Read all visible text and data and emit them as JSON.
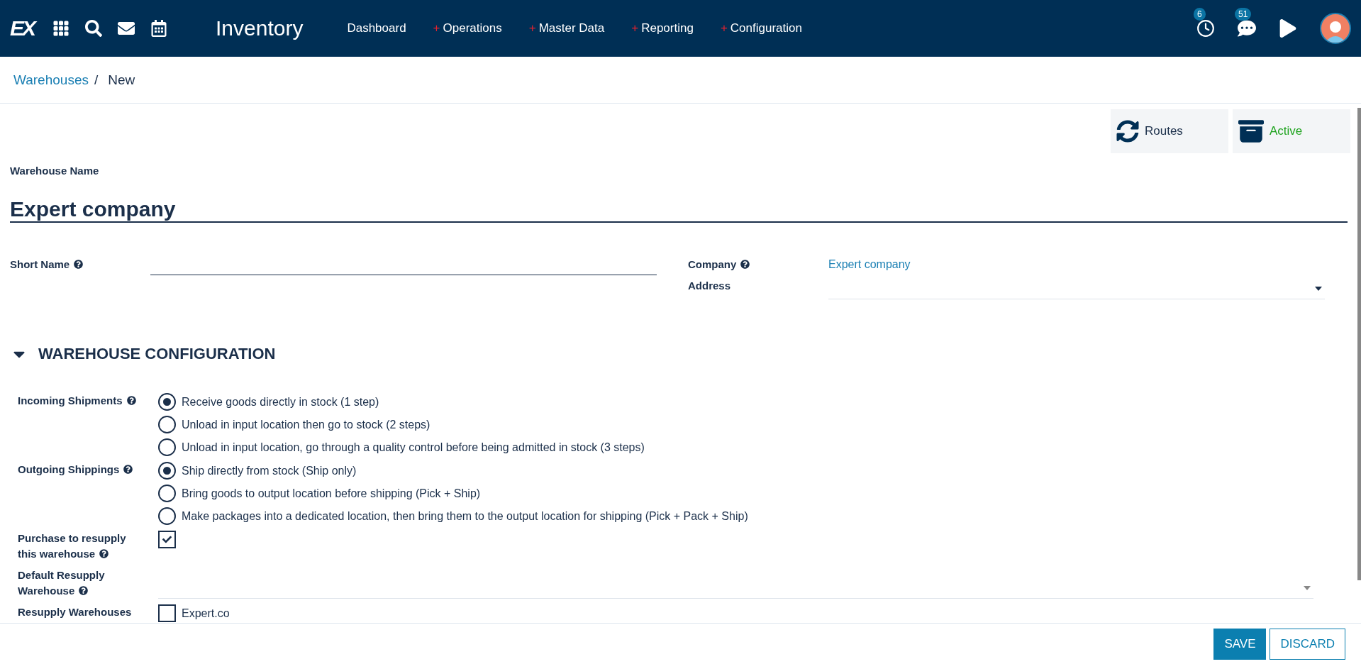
{
  "navbar": {
    "logo": "EX",
    "app_title": "Inventory",
    "menu": [
      {
        "label": "Dashboard"
      },
      {
        "label": "Operations",
        "marker": "+"
      },
      {
        "label": "Master Data",
        "marker": "+"
      },
      {
        "label": "Reporting",
        "marker": "+"
      },
      {
        "label": "Configuration",
        "marker": "+"
      }
    ],
    "activity_count": "6",
    "message_count": "51"
  },
  "breadcrumb": {
    "parent": "Warehouses",
    "separator": "/",
    "current": "New"
  },
  "smart_buttons": [
    {
      "kind": "routes",
      "label": "Routes"
    },
    {
      "kind": "active",
      "label": "Active"
    }
  ],
  "form": {
    "name_label": "Warehouse Name",
    "name_value": "Expert company",
    "short_name": {
      "label": "Short Name"
    },
    "company": {
      "label": "Company",
      "value": "Expert company"
    },
    "address": {
      "label": "Address"
    }
  },
  "config": {
    "title": "WAREHOUSE CONFIGURATION",
    "expanded": true,
    "fields": [
      {
        "kind": "radio",
        "label": "Incoming Shipments",
        "help": true,
        "options": [
          {
            "label": "Receive goods directly in stock (1 step)",
            "selected": true
          },
          {
            "label": "Unload in input location then go to stock (2 steps)",
            "selected": false
          },
          {
            "label": "Unload in input location, go through a quality control before being admitted in stock (3 steps)",
            "selected": false
          }
        ]
      },
      {
        "kind": "radio",
        "label": "Outgoing Shippings",
        "help": true,
        "options": [
          {
            "label": "Ship directly from stock (Ship only)",
            "selected": true
          },
          {
            "label": "Bring goods to output location before shipping (Pick + Ship)",
            "selected": false
          },
          {
            "label": "Make packages into a dedicated location, then bring them to the output location for shipping (Pick + Pack + Ship)",
            "selected": false
          }
        ]
      },
      {
        "kind": "checkbox",
        "label": "Purchase to resupply this warehouse",
        "help": true,
        "checked": true
      },
      {
        "kind": "select",
        "label": "Default Resupply Warehouse",
        "help": true
      },
      {
        "kind": "checklist",
        "label": "Resupply Warehouses",
        "help": false,
        "options": [
          {
            "label": "Expert.co",
            "checked": false
          }
        ]
      }
    ]
  },
  "footer": {
    "buttons": [
      {
        "kind": "primary",
        "label": "SAVE"
      },
      {
        "kind": "secondary",
        "label": "DISCARD"
      }
    ]
  }
}
